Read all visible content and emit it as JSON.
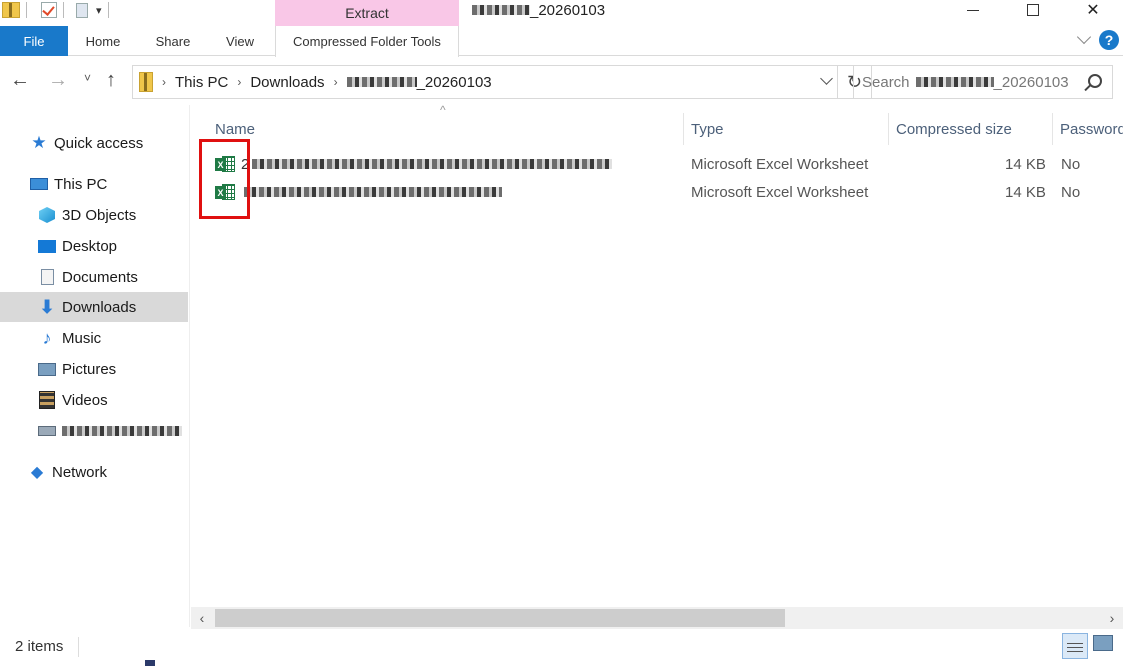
{
  "titlebar": {
    "contextual_tab_group": "Extract",
    "title_suffix": "_20260103"
  },
  "ribbon": {
    "tabs": [
      "File",
      "Home",
      "Share",
      "View",
      "Compressed Folder Tools"
    ],
    "help_label": "?"
  },
  "address": {
    "crumbs": [
      "This PC",
      "Downloads",
      "_20260103"
    ],
    "search_placeholder": "Search",
    "search_suffix": "_20260103"
  },
  "navigation": {
    "items": [
      {
        "label": "Quick access",
        "icon": "star-icon"
      },
      {
        "label": "This PC",
        "icon": "computer-icon"
      },
      {
        "label": "3D Objects",
        "icon": "cube-icon"
      },
      {
        "label": "Desktop",
        "icon": "desktop-icon"
      },
      {
        "label": "Documents",
        "icon": "documents-icon"
      },
      {
        "label": "Downloads",
        "icon": "download-icon",
        "selected": true
      },
      {
        "label": "Music",
        "icon": "music-icon"
      },
      {
        "label": "Pictures",
        "icon": "pictures-icon"
      },
      {
        "label": "Videos",
        "icon": "videos-icon"
      },
      {
        "label": "",
        "icon": "drive-icon"
      },
      {
        "label": "Network",
        "icon": "network-icon"
      }
    ]
  },
  "columns": {
    "name": "Name",
    "type": "Type",
    "compressed_size": "Compressed size",
    "password": "Password"
  },
  "files": [
    {
      "name_prefix": "2",
      "type": "Microsoft Excel Worksheet",
      "size": "14 KB",
      "password": "No"
    },
    {
      "name_prefix": "",
      "type": "Microsoft Excel Worksheet",
      "size": "14 KB",
      "password": "No"
    }
  ],
  "status": {
    "item_count": "2 items"
  },
  "colors": {
    "accent": "#1979ca",
    "contextual_tab": "#f9c7e7",
    "highlight_box": "#e01010",
    "excel_green": "#1f7a45"
  }
}
